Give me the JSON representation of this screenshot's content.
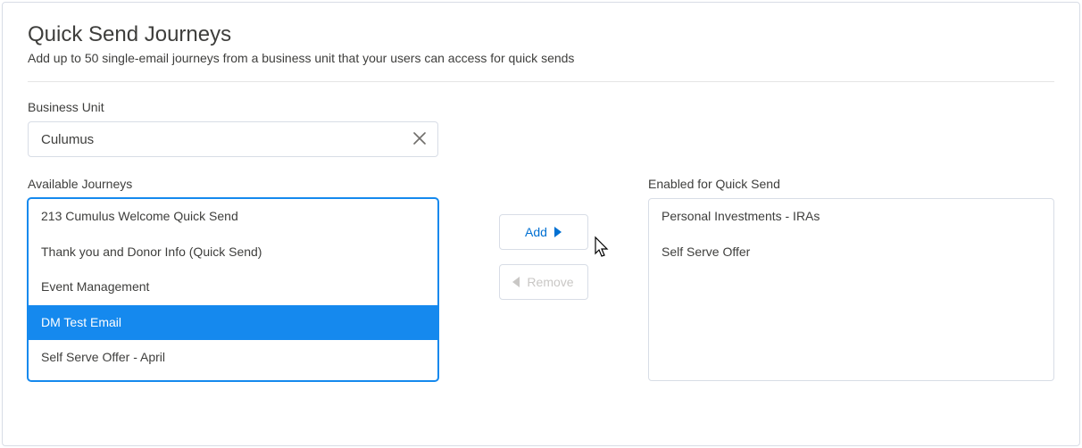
{
  "header": {
    "title": "Quick Send Journeys",
    "subtitle": "Add up to 50 single-email journeys from a business unit that your users can access for quick sends"
  },
  "business_unit": {
    "label": "Business Unit",
    "value": "Culumus"
  },
  "available": {
    "label": "Available Journeys",
    "items": [
      "213 Cumulus Welcome Quick Send",
      "Thank you and Donor Info (Quick Send)",
      "Event Management",
      "DM Test Email",
      "Self Serve Offer - April"
    ],
    "selected_index": 3
  },
  "enabled": {
    "label": "Enabled for Quick Send",
    "items": [
      "Personal Investments - IRAs",
      "Self Serve Offer"
    ]
  },
  "actions": {
    "add": "Add",
    "remove": "Remove"
  }
}
